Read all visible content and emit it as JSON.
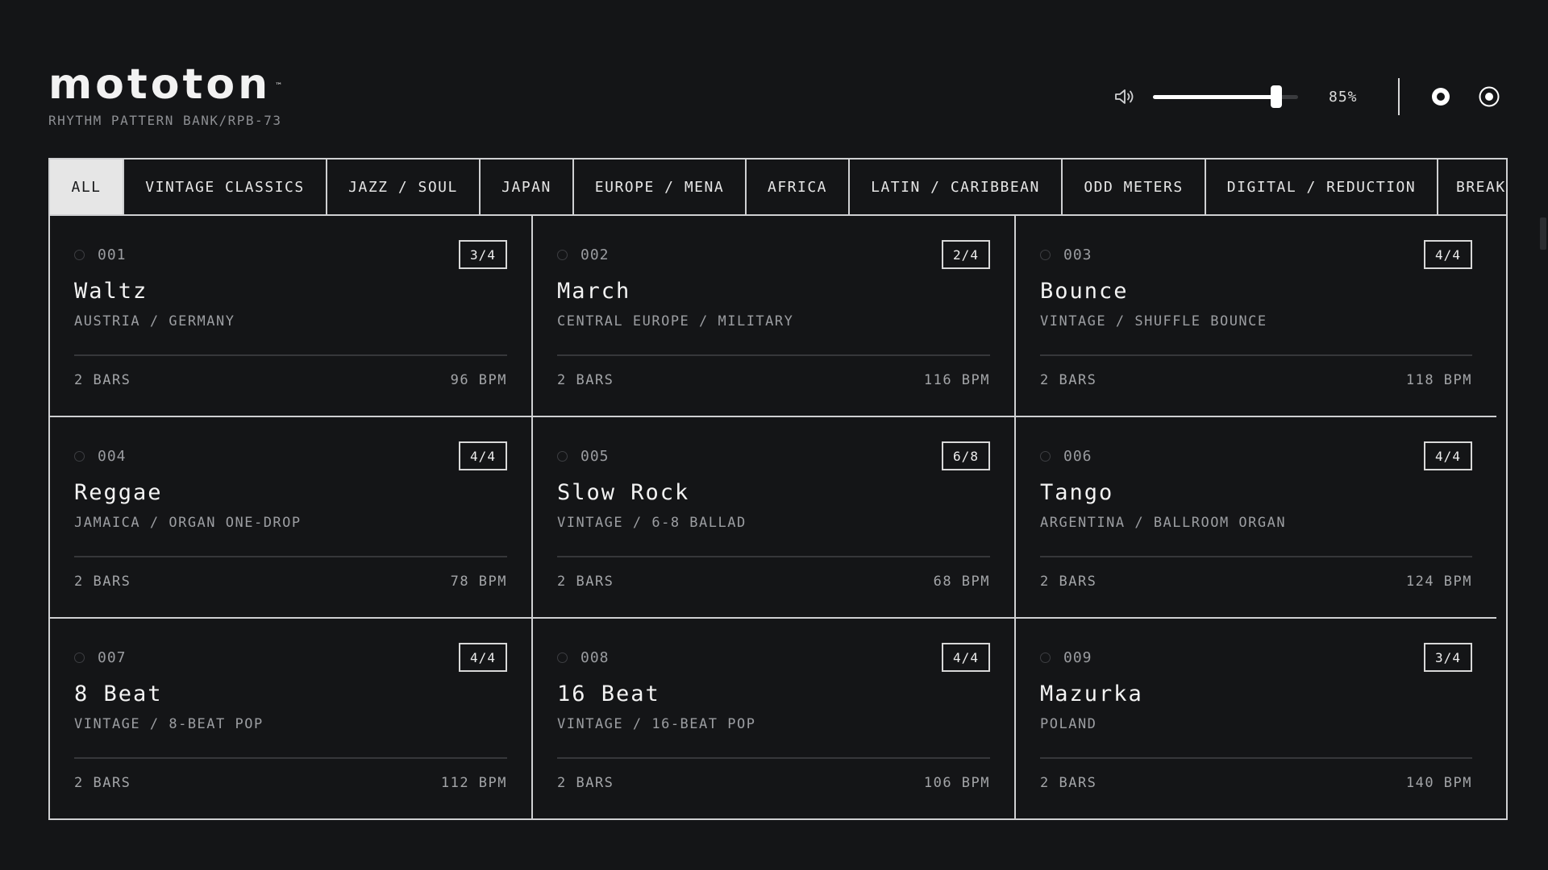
{
  "header": {
    "logo": "mototon",
    "trademark": "™",
    "subtitle": "RHYTHM PATTERN BANK/RPB-73"
  },
  "controls": {
    "volume_icon": "speaker-icon",
    "volume": 85,
    "volume_readout": "85%",
    "button_1_icon": "record-dot-icon",
    "button_2_icon": "target-ring-icon"
  },
  "tabs": [
    {
      "label": "ALL",
      "active": true
    },
    {
      "label": "VINTAGE CLASSICS",
      "active": false
    },
    {
      "label": "JAZZ / SOUL",
      "active": false
    },
    {
      "label": "JAPAN",
      "active": false
    },
    {
      "label": "EUROPE / MENA",
      "active": false
    },
    {
      "label": "AFRICA",
      "active": false
    },
    {
      "label": "LATIN / CARIBBEAN",
      "active": false
    },
    {
      "label": "ODD METERS",
      "active": false
    },
    {
      "label": "DIGITAL / REDUCTION",
      "active": false
    },
    {
      "label": "BREAKS",
      "active": false
    }
  ],
  "patterns": [
    {
      "num": "001",
      "meter": "3/4",
      "name": "Waltz",
      "origin": "AUSTRIA / GERMANY",
      "bars": "2 BARS",
      "bpm": "96 BPM"
    },
    {
      "num": "002",
      "meter": "2/4",
      "name": "March",
      "origin": "CENTRAL EUROPE / MILITARY",
      "bars": "2 BARS",
      "bpm": "116 BPM"
    },
    {
      "num": "003",
      "meter": "4/4",
      "name": "Bounce",
      "origin": "VINTAGE / SHUFFLE BOUNCE",
      "bars": "2 BARS",
      "bpm": "118 BPM"
    },
    {
      "num": "004",
      "meter": "4/4",
      "name": "Reggae",
      "origin": "JAMAICA / ORGAN ONE-DROP",
      "bars": "2 BARS",
      "bpm": "78 BPM"
    },
    {
      "num": "005",
      "meter": "6/8",
      "name": "Slow Rock",
      "origin": "VINTAGE / 6-8 BALLAD",
      "bars": "2 BARS",
      "bpm": "68 BPM"
    },
    {
      "num": "006",
      "meter": "4/4",
      "name": "Tango",
      "origin": "ARGENTINA / BALLROOM ORGAN",
      "bars": "2 BARS",
      "bpm": "124 BPM"
    },
    {
      "num": "007",
      "meter": "4/4",
      "name": "8 Beat",
      "origin": "VINTAGE / 8-BEAT POP",
      "bars": "2 BARS",
      "bpm": "112 BPM"
    },
    {
      "num": "008",
      "meter": "4/4",
      "name": "16 Beat",
      "origin": "VINTAGE / 16-BEAT POP",
      "bars": "2 BARS",
      "bpm": "106 BPM"
    },
    {
      "num": "009",
      "meter": "3/4",
      "name": "Mazurka",
      "origin": "POLAND",
      "bars": "2 BARS",
      "bpm": "140 BPM"
    }
  ],
  "colors": {
    "background": "#141517",
    "foreground": "#e9e9e9",
    "muted": "#9c9ea2",
    "border": "#cfd0d2"
  }
}
